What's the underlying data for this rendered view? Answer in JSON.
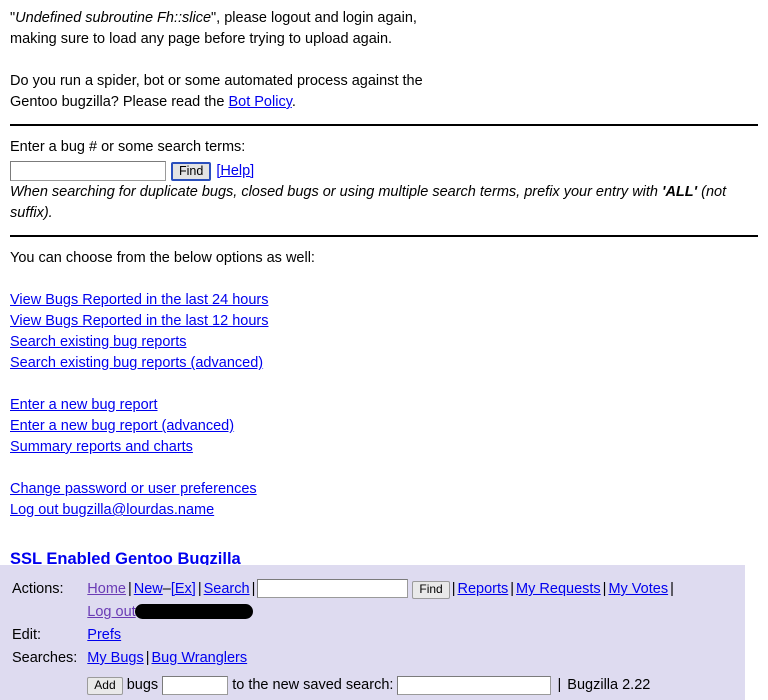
{
  "notice": {
    "error_quoted_start": "\"",
    "error_italic": "Undefined subroutine Fh::slice",
    "error_quoted_end": "\", please logout and login again,",
    "line2": "making sure to load any page before trying to upload again."
  },
  "bot": {
    "line1": "Do you run a spider, bot or some automated process against the",
    "line2_pre": "Gentoo bugzilla? Please read the ",
    "link": "Bot Policy",
    "line2_post": "."
  },
  "quicksearch": {
    "label": "Enter a bug # or some search terms:",
    "input_value": "",
    "input_placeholder": "",
    "find_label": "Find",
    "help_label": "[Help]",
    "hint_pre": "When searching for duplicate bugs, closed bugs or using multiple search terms, prefix your entry with ",
    "hint_bold": "'ALL'",
    "hint_post": " (not suffix)."
  },
  "options": {
    "heading": "You can choose from the below options as well:",
    "group1": [
      "View Bugs Reported in the last 24 hours",
      "View Bugs Reported in the last 12 hours",
      "Search existing bug reports",
      "Search existing bug reports (advanced)"
    ],
    "group2": [
      "Enter a new bug report",
      "Enter a new bug report (advanced)",
      "Summary reports and charts"
    ],
    "group3": [
      "Change password or user preferences",
      "Log out bugzilla@lourdas.name"
    ]
  },
  "site": {
    "title_link": "SSL Enabled Gentoo Bugzilla"
  },
  "footer": {
    "actions_label": "Actions:",
    "edit_label": "Edit:",
    "searches_label": "Searches:",
    "action_links": {
      "home": "Home",
      "new": "New",
      "new_dash": "–",
      "ex": "[Ex]",
      "search": "Search",
      "reports": "Reports",
      "my_requests": "My Requests",
      "my_votes": "My Votes",
      "logout": "Log out"
    },
    "find_input_value": "",
    "find_label": "Find",
    "edit_links": {
      "prefs": "Prefs"
    },
    "searches_links": {
      "my_bugs": "My Bugs",
      "bug_wranglers": "Bug Wranglers"
    },
    "saved_search": {
      "add_label": "Add",
      "bugs_label": "bugs",
      "bugs_value": "",
      "to_label": "to the new saved search:",
      "name_value": "",
      "version_sep": "|",
      "version": "Bugzilla 2.22"
    },
    "separator": "|",
    "background": "#dedbf0"
  },
  "colors": {
    "link": "#0000ee",
    "visited": "#551a8b",
    "rule": "#000000"
  }
}
